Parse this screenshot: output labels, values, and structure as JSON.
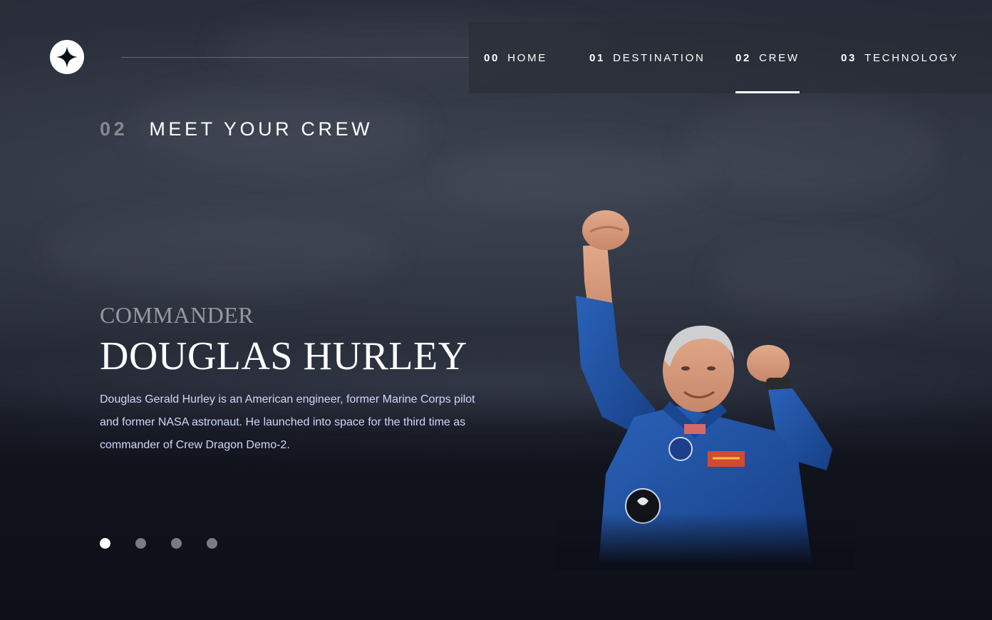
{
  "logo": {
    "icon": "four-point-star-icon"
  },
  "nav": {
    "items": [
      {
        "num": "00",
        "label": "HOME",
        "active": false
      },
      {
        "num": "01",
        "label": "DESTINATION",
        "active": false
      },
      {
        "num": "02",
        "label": "CREW",
        "active": true
      },
      {
        "num": "03",
        "label": "TECHNOLOGY",
        "active": false
      }
    ]
  },
  "heading": {
    "num": "02",
    "text": "MEET YOUR CREW"
  },
  "crew": {
    "role": "COMMANDER",
    "name": "DOUGLAS HURLEY",
    "bio": "Douglas Gerald Hurley is an American engineer, former Marine Corps pilot and former NASA astronaut. He launched into space for the third time as commander of Crew Dragon Demo-2.",
    "active_index": 0,
    "total": 4
  },
  "colors": {
    "background": "#0b0d17",
    "accent": "#ffffff",
    "body_text": "#d0d6f9",
    "suit_blue": "#1d4f9f"
  }
}
